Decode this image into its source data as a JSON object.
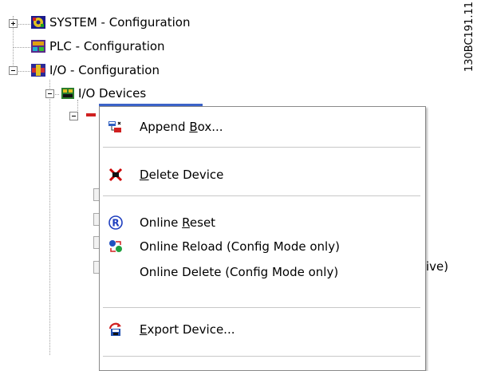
{
  "figure_code": "130BC191.11",
  "tree": {
    "items": [
      {
        "label": "SYSTEM - Configuration",
        "expander": "plus",
        "icon": "system-config-icon"
      },
      {
        "label": "PLC - Configuration",
        "expander": "none",
        "icon": "plc-config-icon"
      },
      {
        "label": "I/O - Configuration",
        "expander": "minus",
        "icon": "io-config-icon"
      },
      {
        "label": "I/O Devices",
        "expander": "minus",
        "icon": "io-devices-icon"
      }
    ],
    "partial_text": "ive)"
  },
  "context_menu": {
    "items": [
      {
        "pre": "Append ",
        "accel": "B",
        "post": "ox...",
        "icon": "append-box-icon"
      },
      {
        "pre": "",
        "accel": "D",
        "post": "elete Device",
        "icon": "delete-device-icon"
      },
      {
        "pre": "Online ",
        "accel": "R",
        "post": "eset",
        "icon": "online-reset-icon"
      },
      {
        "pre": "Online Reload (Config Mode only)",
        "accel": "",
        "post": "",
        "icon": "online-reload-icon"
      },
      {
        "pre": "Online Delete (Config Mode only)",
        "accel": "",
        "post": "",
        "icon": ""
      },
      {
        "pre": "",
        "accel": "E",
        "post": "xport Device...",
        "icon": "export-device-icon"
      }
    ]
  },
  "colors": {
    "menu_border": "#8a8a8a",
    "separator": "#c8c8c8",
    "tree_line": "#a0a0a0",
    "reset_icon": "#1f3fbf",
    "delete_icon": "#cc0000"
  }
}
